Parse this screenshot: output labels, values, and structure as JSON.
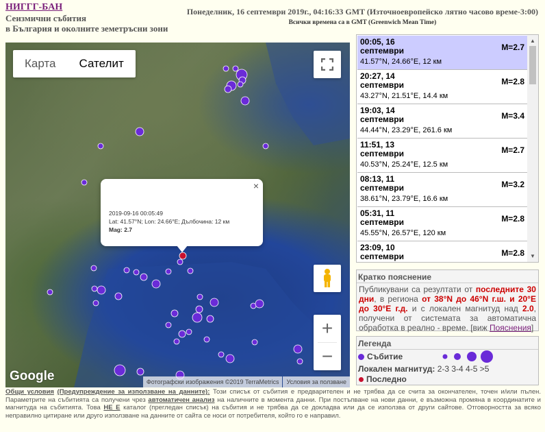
{
  "header": {
    "title": "НИГГГ-БАН",
    "subtitle1": "Сеизмични събития",
    "subtitle2": "в България и околните земетръсни зони",
    "datetime": "Понеделник, 16 септември 2019г., 04:16:33 GMT (Източноевропейско лятно часово време-3:00)",
    "gmt_note": "Всички времена са в GMT (Greenwich Mean Time)"
  },
  "map": {
    "type_map": "Карта",
    "type_satellite": "Сателит",
    "zoom_in": "+",
    "zoom_out": "−",
    "google": "Google",
    "attribution": "Фотографски изображения ©2019 TerraMetrics",
    "terms": "Условия за ползване",
    "popup": {
      "close": "×",
      "time": "2019-09-16 00:05:49",
      "details": "Lat: 41.57°N; Lon: 24.66°E; Дълбочина: 12 км",
      "mag_label": "Mag:",
      "mag_value": "2.7"
    },
    "event_color": "#6a2bd8",
    "last_color": "#c8102e"
  },
  "events": [
    {
      "time": "00:05, 16 септември",
      "mag": "M=2.7",
      "coords": "41.57°N, 24.66°E, 12 км"
    },
    {
      "time": "20:27, 14 септември",
      "mag": "M=2.8",
      "coords": "43.27°N, 21.51°E, 14.4 км"
    },
    {
      "time": "19:03, 14 септември",
      "mag": "M=3.4",
      "coords": "44.44°N, 23.29°E, 261.6 км"
    },
    {
      "time": "11:51, 13 септември",
      "mag": "M=2.7",
      "coords": "40.53°N, 25.24°E, 12.5 км"
    },
    {
      "time": "08:13, 11 септември",
      "mag": "M=3.2",
      "coords": "38.61°N, 23.79°E, 16.6 км"
    },
    {
      "time": "05:31, 11 септември",
      "mag": "M=2.8",
      "coords": "45.55°N, 26.57°E, 120 км"
    },
    {
      "time": "23:09, 10 септември",
      "mag": "M=2.8",
      "coords": ""
    }
  ],
  "explain": {
    "title": "Кратко пояснение",
    "p1": "Публикувани са резултати от ",
    "r1": "последните 30 дни",
    "p2": ", в региона ",
    "r2": "от 38°N до 46°N г.ш. и 20°E до 30°E г.д.",
    "p3": " и с локален магнитуд над ",
    "r3": "2.0",
    "p4": ", получени от системата за автоматична обработка в реално - време. [виж ",
    "link": "Пояснения",
    "p5": "]"
  },
  "legend": {
    "title": "Легенда",
    "event": "Събитие",
    "magnitude": "Локален магнитуд:",
    "ranges": "2-3 3-4 4-5 >5",
    "last": "Последно"
  },
  "footer": {
    "terms": "Общи условия",
    "warning": "(Предупреждение за използване на данните):",
    "t1": " Този списък от събития е предварителен и не трябва да се счита за окончателен, точен и/или пълен. Параметрите на събитията са получени чрез ",
    "auto": "автоматичен анализ",
    "t2": " на наличните в момента данни. При постъпване на нови данни, е възможна промяна в координатите и магнитуда на събитията. Това ",
    "not": "НЕ Е",
    "t3": " каталог (прегледан списък) на събития и не трябва да се докладва или да се използва от други сайтове. Отговорността за всяко неправилно цитиране или друго използване на данните от сайта се носи от потребителя, който го е направил."
  }
}
